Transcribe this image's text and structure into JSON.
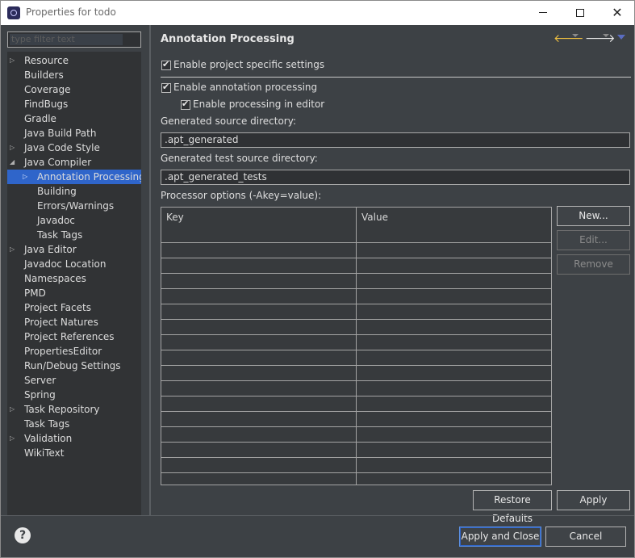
{
  "window": {
    "title": "Properties for todo",
    "min_icon": "minimize-icon",
    "max_icon": "maximize-icon",
    "close_icon": "close-icon"
  },
  "filter": {
    "placeholder": "type filter text"
  },
  "tree": {
    "items": [
      {
        "label": "Resource",
        "expandable": true
      },
      {
        "label": "Builders"
      },
      {
        "label": "Coverage"
      },
      {
        "label": "FindBugs"
      },
      {
        "label": "Gradle"
      },
      {
        "label": "Java Build Path"
      },
      {
        "label": "Java Code Style",
        "expandable": true
      },
      {
        "label": "Java Compiler",
        "expanded": true
      },
      {
        "label": "Annotation Processing",
        "expandable": true,
        "selected": true
      },
      {
        "label": "Building"
      },
      {
        "label": "Errors/Warnings"
      },
      {
        "label": "Javadoc"
      },
      {
        "label": "Task Tags"
      },
      {
        "label": "Java Editor",
        "expandable": true
      },
      {
        "label": "Javadoc Location"
      },
      {
        "label": "Namespaces"
      },
      {
        "label": "PMD"
      },
      {
        "label": "Project Facets"
      },
      {
        "label": "Project Natures"
      },
      {
        "label": "Project References"
      },
      {
        "label": "PropertiesEditor"
      },
      {
        "label": "Run/Debug Settings"
      },
      {
        "label": "Server"
      },
      {
        "label": "Spring"
      },
      {
        "label": "Task Repository",
        "expandable": true
      },
      {
        "label": "Task Tags"
      },
      {
        "label": "Validation",
        "expandable": true
      },
      {
        "label": "WikiText"
      }
    ]
  },
  "page": {
    "title": "Annotation Processing",
    "enable_project_specific": "Enable project specific settings",
    "enable_annotation_processing": "Enable annotation processing",
    "enable_in_editor": "Enable processing in editor",
    "gen_source_label": "Generated source directory:",
    "gen_source_value": ".apt_generated",
    "gen_test_label": "Generated test source directory:",
    "gen_test_value": ".apt_generated_tests",
    "processor_options_label": "Processor options (-Akey=value):",
    "table_headers": {
      "key": "Key",
      "value": "Value"
    },
    "buttons": {
      "new": "New...",
      "edit": "Edit...",
      "remove": "Remove"
    },
    "restore_defaults": "Restore Defaults",
    "apply": "Apply"
  },
  "footer": {
    "help_icon": "help-icon",
    "apply_and_close": "Apply and Close",
    "cancel": "Cancel"
  },
  "colors": {
    "background": "#3d4145",
    "selection": "#2f65ca",
    "tree_background": "#313335"
  }
}
